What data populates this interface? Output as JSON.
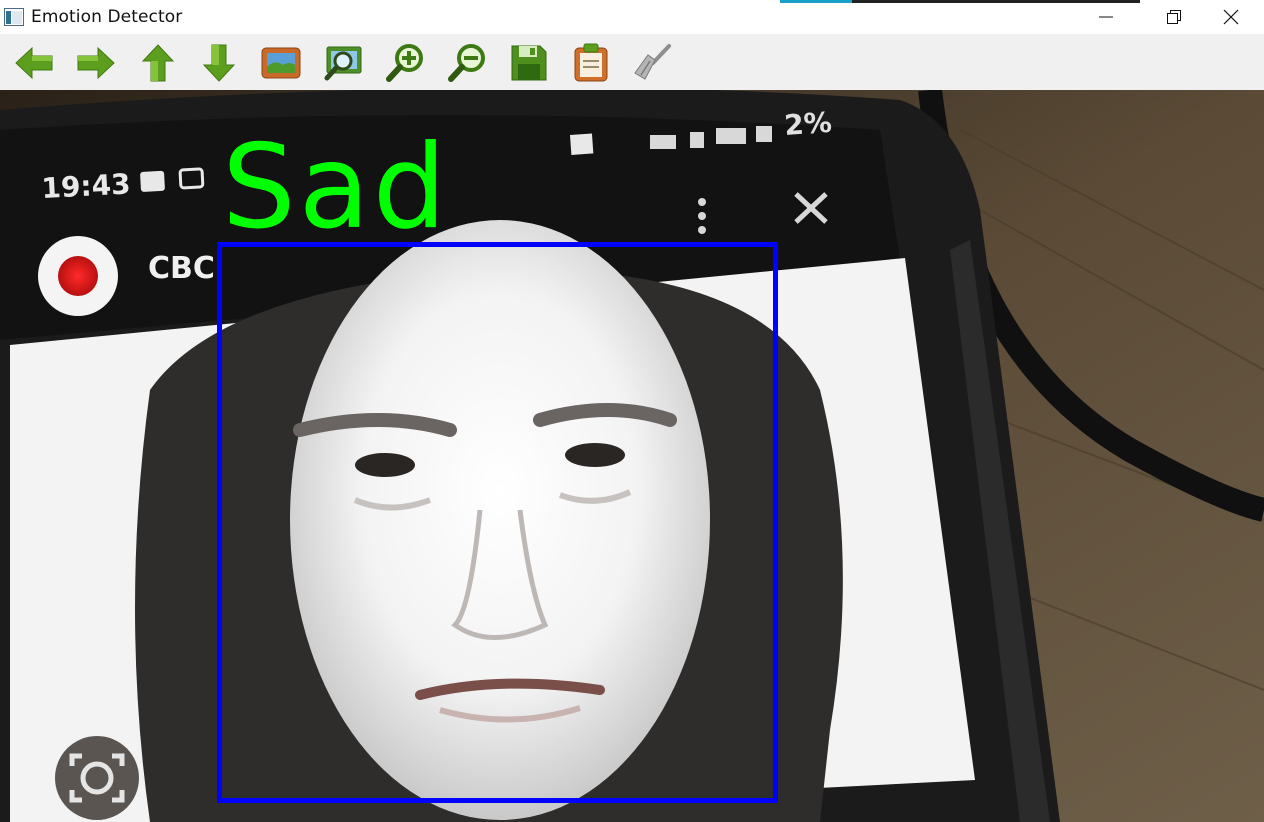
{
  "window": {
    "title": "Emotion Detector",
    "controls": [
      "minimize",
      "restore",
      "close"
    ],
    "progress_fraction": 0.2
  },
  "toolbar": {
    "buttons": [
      {
        "name": "back-button",
        "icon": "arrow-left-icon"
      },
      {
        "name": "forward-button",
        "icon": "arrow-right-icon"
      },
      {
        "name": "up-button",
        "icon": "arrow-up-icon"
      },
      {
        "name": "down-button",
        "icon": "arrow-down-icon"
      },
      {
        "name": "image-button",
        "icon": "picture-icon"
      },
      {
        "name": "zoom-fit-button",
        "icon": "magnifier-picture-icon"
      },
      {
        "name": "zoom-in-button",
        "icon": "zoom-in-icon"
      },
      {
        "name": "zoom-out-button",
        "icon": "zoom-out-icon"
      },
      {
        "name": "save-button",
        "icon": "floppy-disk-icon"
      },
      {
        "name": "copy-button",
        "icon": "clipboard-icon"
      },
      {
        "name": "clear-button",
        "icon": "broom-icon"
      }
    ]
  },
  "viewport": {
    "emotion_label": "Sad",
    "label_color": "#00ff00",
    "box_color": "#0000ff",
    "phone_screen": {
      "time": "19:43",
      "app_name": "CBC",
      "battery": "2%"
    }
  }
}
